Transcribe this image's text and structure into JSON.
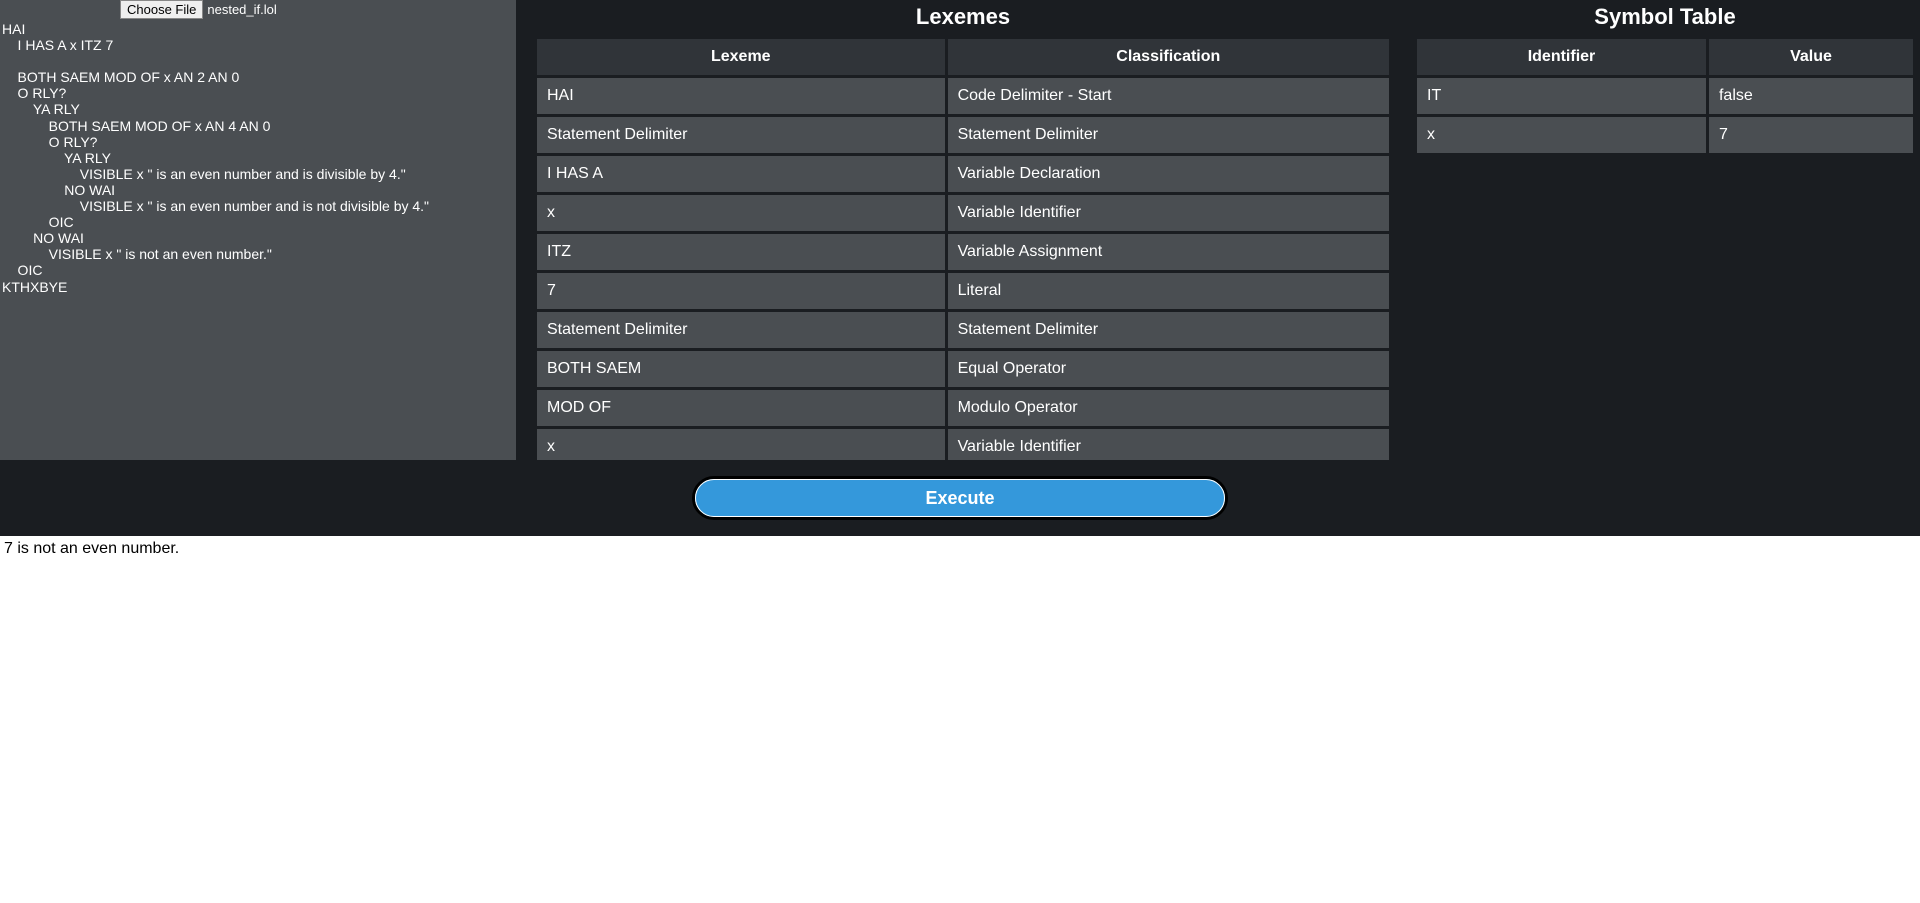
{
  "file": {
    "choose_label": "Choose File",
    "filename": "nested_if.lol"
  },
  "code": "HAI\n    I HAS A x ITZ 7\n\n    BOTH SAEM MOD OF x AN 2 AN 0\n    O RLY?\n        YA RLY\n            BOTH SAEM MOD OF x AN 4 AN 0\n            O RLY?\n                YA RLY\n                    VISIBLE x \" is an even number and is divisible by 4.\"\n                NO WAI\n                    VISIBLE x \" is an even number and is not divisible by 4.\"\n            OIC\n        NO WAI\n            VISIBLE x \" is not an even number.\"\n    OIC\nKTHXBYE",
  "lexemes": {
    "title": "Lexemes",
    "headers": [
      "Lexeme",
      "Classification"
    ],
    "rows": [
      [
        "HAI",
        "Code Delimiter - Start"
      ],
      [
        "Statement Delimiter",
        "Statement Delimiter"
      ],
      [
        "I HAS A",
        "Variable Declaration"
      ],
      [
        "x",
        "Variable Identifier"
      ],
      [
        "ITZ",
        "Variable Assignment"
      ],
      [
        "7",
        "Literal"
      ],
      [
        "Statement Delimiter",
        "Statement Delimiter"
      ],
      [
        "BOTH SAEM",
        "Equal Operator"
      ],
      [
        "MOD OF",
        "Modulo Operator"
      ],
      [
        "x",
        "Variable Identifier"
      ]
    ]
  },
  "symbol_table": {
    "title": "Symbol Table",
    "headers": [
      "Identifier",
      "Value"
    ],
    "rows": [
      [
        "IT",
        "false"
      ],
      [
        "x",
        "7"
      ]
    ]
  },
  "execute_label": "Execute",
  "output": "7 is not an even number."
}
